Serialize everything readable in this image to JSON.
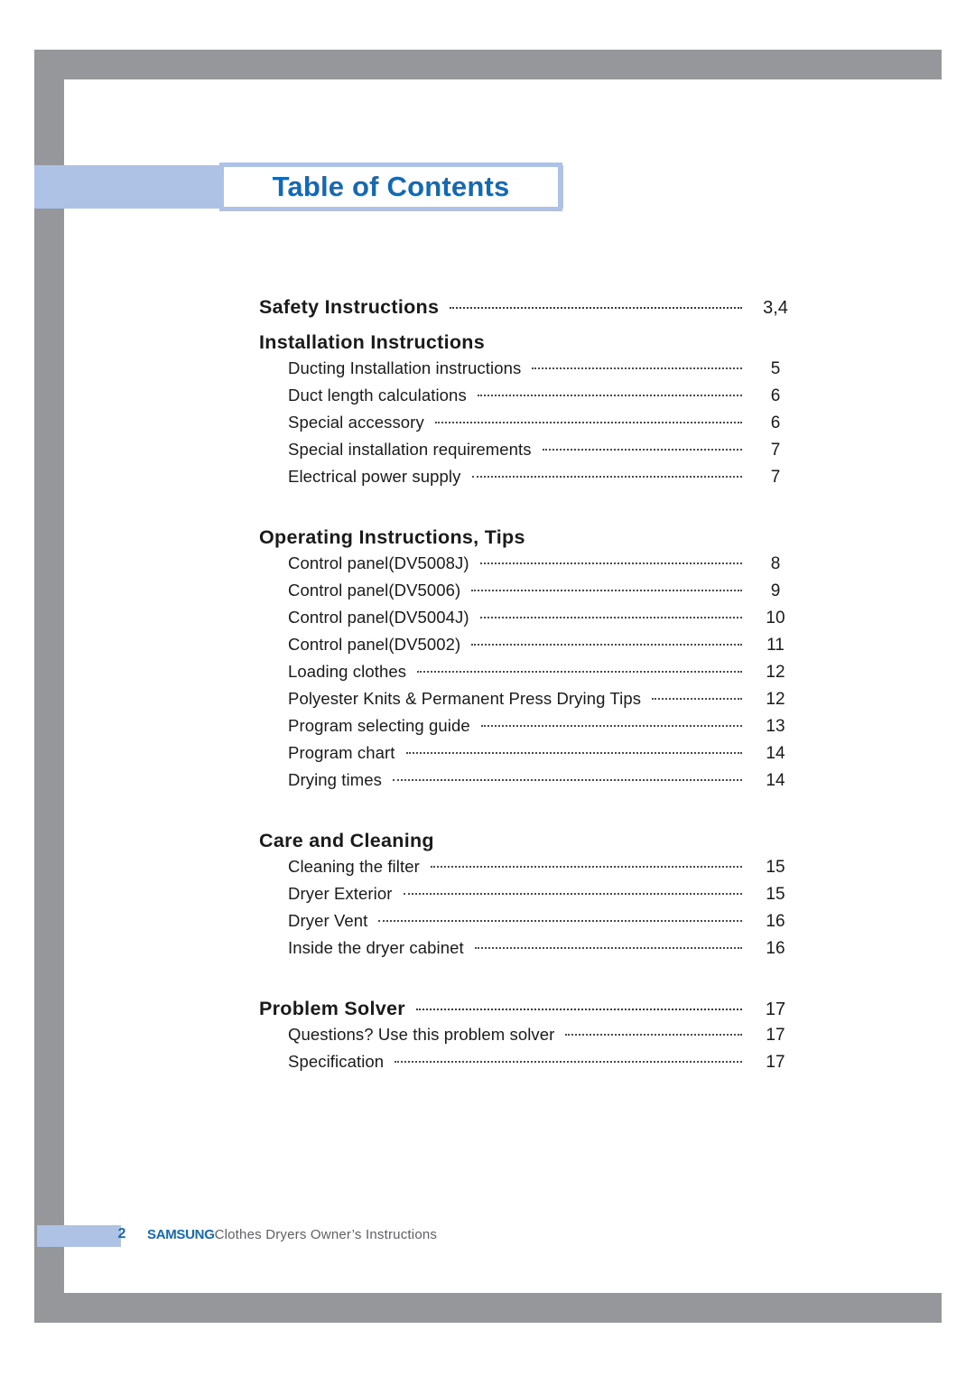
{
  "page": {
    "title": "Table of Contents"
  },
  "toc": {
    "sections": [
      {
        "heading": "Safety Instructions",
        "page": "3,4",
        "items": []
      },
      {
        "heading": "Installation Instructions",
        "page": "",
        "items": [
          {
            "label": "Ducting Installation instructions",
            "page": "5"
          },
          {
            "label": "Duct length calculations",
            "page": "6"
          },
          {
            "label": "Special accessory",
            "page": "6"
          },
          {
            "label": "Special installation requirements",
            "page": "7"
          },
          {
            "label": "Electrical power supply",
            "page": "7"
          }
        ]
      },
      {
        "heading": "Operating Instructions, Tips",
        "page": "",
        "items": [
          {
            "label": "Control panel(DV5008J)",
            "page": "8"
          },
          {
            "label": "Control panel(DV5006)",
            "page": "9"
          },
          {
            "label": "Control panel(DV5004J)",
            "page": "10"
          },
          {
            "label": "Control panel(DV5002)",
            "page": "11"
          },
          {
            "label": "Loading clothes",
            "page": "12"
          },
          {
            "label": "Polyester Knits & Permanent Press Drying Tips",
            "page": "12"
          },
          {
            "label": "Program selecting guide",
            "page": "13"
          },
          {
            "label": "Program chart",
            "page": "14"
          },
          {
            "label": "Drying times",
            "page": "14"
          }
        ]
      },
      {
        "heading": "Care and Cleaning",
        "page": "",
        "items": [
          {
            "label": "Cleaning the filter",
            "page": "15"
          },
          {
            "label": "Dryer Exterior",
            "page": "15"
          },
          {
            "label": "Dryer Vent",
            "page": "16"
          },
          {
            "label": "Inside the dryer cabinet",
            "page": "16"
          }
        ]
      },
      {
        "heading": "Problem Solver",
        "page": "17",
        "items": [
          {
            "label": "Questions? Use this problem solver",
            "page": "17"
          },
          {
            "label": "Specification",
            "page": "17"
          }
        ]
      }
    ]
  },
  "footer": {
    "page_number": "2",
    "brand": "SAMSUNG",
    "text": "Clothes Dryers Owner’s Instructions"
  },
  "colors": {
    "frame_gray": "#95979a",
    "accent_light_blue": "#aec2e6",
    "brand_blue": "#1469b4"
  }
}
